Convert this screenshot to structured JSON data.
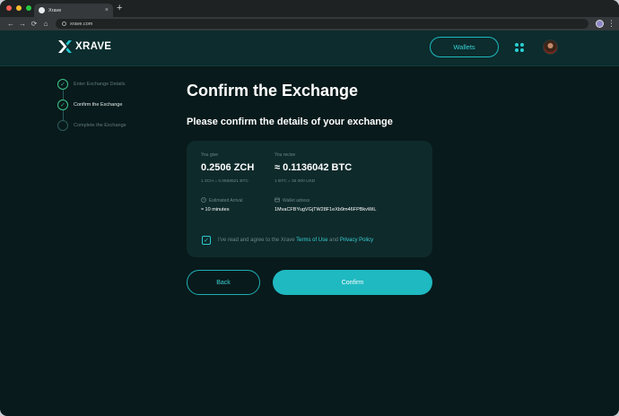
{
  "browser": {
    "tab_title": "Xrave",
    "tab_close": "×",
    "new_tab": "+",
    "url": "xrave.com",
    "nav": {
      "back": "←",
      "forward": "→",
      "reload": "⟳",
      "home": "⌂"
    },
    "menu": "⋮",
    "traffic_colors": [
      "#ff5f57",
      "#febc2e",
      "#28c840"
    ]
  },
  "header": {
    "logo_text": "XRAVE",
    "wallets_label": "Wallets",
    "accent": "#1fb9c1"
  },
  "stepper": {
    "steps": [
      {
        "label": "Enter Exchange Details",
        "state": "done"
      },
      {
        "label": "Confirm the Exchange",
        "state": "active"
      },
      {
        "label": "Complete the Exchange",
        "state": "pending"
      }
    ],
    "check_glyph": "✓"
  },
  "main": {
    "title": "Confirm the Exchange",
    "subtitle": "Please confirm the details of your exchange",
    "card": {
      "give_label": "You give",
      "give_amount": "0.2506 ZCH",
      "give_rate": "1 ZCH = 0.0568521 BTC",
      "receive_label": "You recive",
      "receive_amount": "≈ 0.1136042 BTC",
      "receive_rate": "1 BTC = 35 000 USD",
      "arrival_label": "Estimated Arrival",
      "arrival_value": "≈ 10 minutes",
      "wallet_label": "Wallet adress",
      "wallet_value": "1MvaCFBYugVGjTW28F1eXb9m46FPBkvWiL",
      "agree_prefix": "I've read and agree to the Xrave",
      "terms_link": "Terms of Use",
      "agree_and": "and",
      "privacy_link": "Privacy Policy",
      "checkbox_glyph": "✓"
    },
    "back_label": "Back",
    "confirm_label": "Confirm"
  }
}
